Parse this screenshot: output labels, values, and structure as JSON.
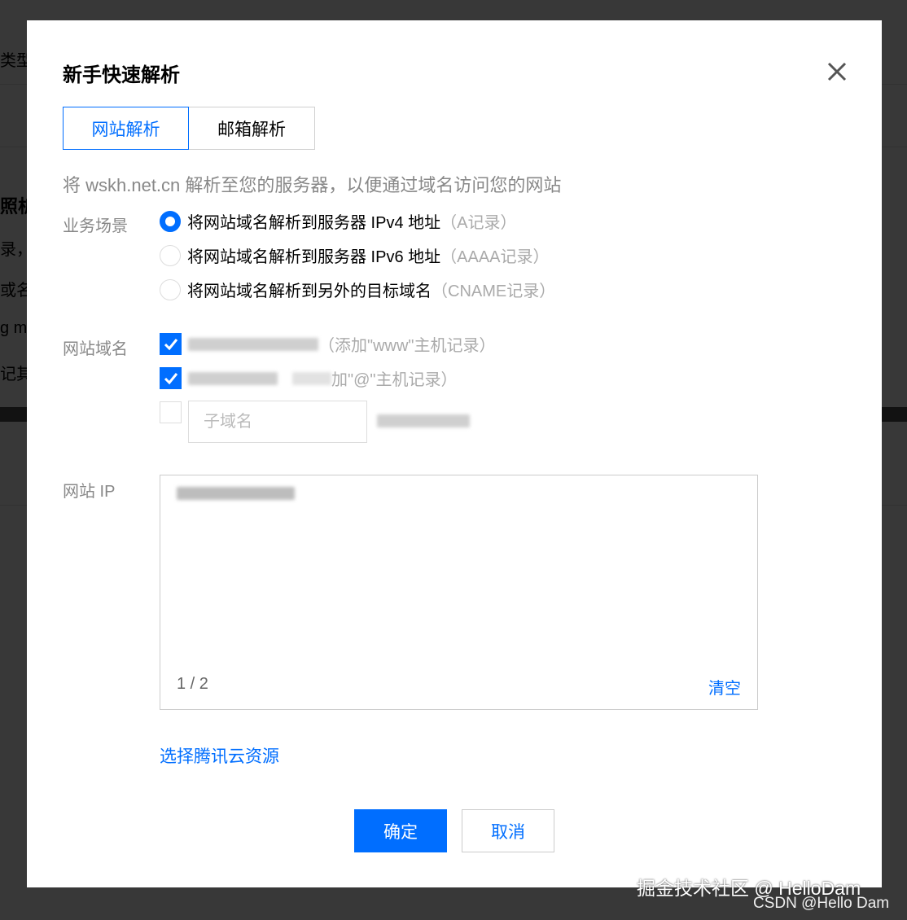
{
  "background": {
    "type_label": "类型",
    "section_title": "照析",
    "row1": "录，",
    "row2": "或名",
    "row3": "g m",
    "row4": "记其"
  },
  "modal": {
    "title": "新手快速解析",
    "close_glyph": "✕",
    "tabs": [
      {
        "label": "网站解析",
        "active": true
      },
      {
        "label": "邮箱解析",
        "active": false
      }
    ],
    "description": "将 wskh.net.cn 解析至您的服务器，以便通过域名访问您的网站",
    "scenario": {
      "label": "业务场景",
      "options": [
        {
          "text": "将网站域名解析到服务器 IPv4 地址",
          "hint": "（A记录）",
          "checked": true
        },
        {
          "text": "将网站域名解析到服务器 IPv6 地址",
          "hint": "（AAAA记录）",
          "checked": false
        },
        {
          "text": "将网站域名解析到另外的目标域名",
          "hint": "（CNAME记录）",
          "checked": false
        }
      ]
    },
    "domain": {
      "label": "网站域名",
      "items": [
        {
          "hint": "（添加\"www\"主机记录）",
          "checked": true
        },
        {
          "hint": "加\"@\"主机记录）",
          "checked": true
        }
      ],
      "subdomain_placeholder": "子域名",
      "check_glyph": "✓"
    },
    "ip": {
      "label": "网站 IP",
      "counter": "1 / 2",
      "clear_label": "清空"
    },
    "resource_link": "选择腾讯云资源",
    "confirm_label": "确定",
    "cancel_label": "取消"
  },
  "watermarks": {
    "juejin": "掘金技术社区 @ HelloDam",
    "csdn": "CSDN @Hello Dam"
  }
}
